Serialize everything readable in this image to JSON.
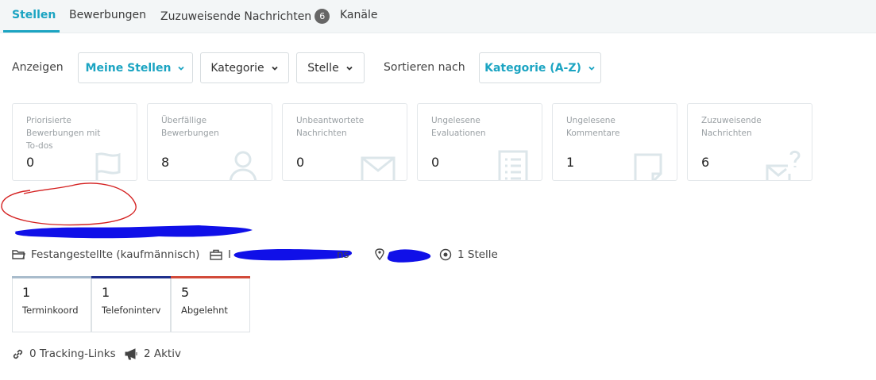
{
  "tabs": [
    {
      "label": "Stellen",
      "active": true
    },
    {
      "label": "Bewerbungen",
      "active": false
    },
    {
      "label": "Zuzuweisende Nachrichten",
      "badge": "6",
      "active": false
    },
    {
      "label": "Kanäle",
      "active": false
    }
  ],
  "filters": {
    "show_label": "Anzeigen",
    "my_jobs": "Meine Stellen",
    "category": "Kategorie",
    "job": "Stelle",
    "sort_label": "Sortieren nach",
    "sort_value": "Kategorie (A-Z)"
  },
  "cards": [
    {
      "title": "Priorisierte Bewerbungen mit To-dos",
      "value": "0",
      "icon": "flag-icon"
    },
    {
      "title": "Überfällige Bewerbungen",
      "value": "8",
      "icon": "user-icon"
    },
    {
      "title": "Unbeantwortete Nachrichten",
      "value": "0",
      "icon": "envelope-icon"
    },
    {
      "title": "Ungelesene Evaluationen",
      "value": "0",
      "icon": "list-icon"
    },
    {
      "title": "Ungelesene Kommentare",
      "value": "1",
      "icon": "note-icon"
    },
    {
      "title": "Zuzuweisende Nachrichten",
      "value": "6",
      "icon": "envelope-question-icon"
    }
  ],
  "job": {
    "employment_type": "Festangestellte (kaufmännisch)",
    "dept_prefix": "I",
    "dept_suffix": "ns",
    "positions": "1 Stelle"
  },
  "pipeline": [
    {
      "value": "1",
      "label": "Terminkoord",
      "color": "#a9bccc"
    },
    {
      "value": "1",
      "label": "Telefoninterv",
      "color": "#1f2f8c"
    },
    {
      "value": "5",
      "label": "Abgelehnt",
      "color": "#d24a3a"
    }
  ],
  "footer": {
    "tracking": "0 Tracking-Links",
    "active": "2 Aktiv"
  },
  "colors": {
    "accent": "#1ba4c2",
    "scribble": "#1010e8",
    "circle": "#d42020"
  }
}
